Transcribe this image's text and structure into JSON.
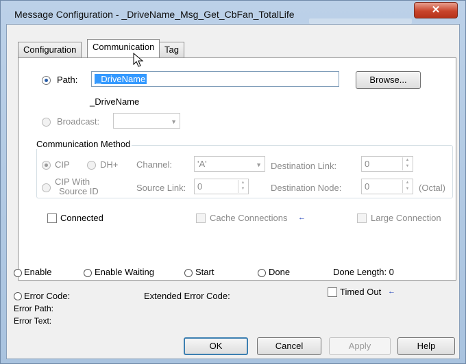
{
  "window": {
    "title": "Message Configuration - _DriveName_Msg_Get_CbFan_TotalLife",
    "close_glyph": "✕"
  },
  "tabs": [
    {
      "label": "Configuration"
    },
    {
      "label": "Communication"
    },
    {
      "label": "Tag"
    }
  ],
  "communication": {
    "path_label": "Path:",
    "path_value": "_DriveName",
    "browse_label": "Browse...",
    "path_resolved": "_DriveName",
    "broadcast_label": "Broadcast:",
    "broadcast_value": ""
  },
  "comm_method": {
    "group_label": "Communication Method",
    "cip_label": "CIP",
    "dhplus_label": "DH+",
    "channel_label": "Channel:",
    "channel_value": "'A'",
    "destination_link_label": "Destination Link:",
    "destination_link_value": "0",
    "cip_source_id_label_1": "CIP With",
    "cip_source_id_label_2": "Source ID",
    "source_link_label": "Source Link:",
    "source_link_value": "0",
    "destination_node_label": "Destination Node:",
    "destination_node_value": "0",
    "octal_label": "(Octal)"
  },
  "options": {
    "connected_label": "Connected",
    "connected_checked": false,
    "cache_label": "Cache Connections",
    "large_label": "Large Connection"
  },
  "status": {
    "enable_label": "Enable",
    "enable_waiting_label": "Enable Waiting",
    "start_label": "Start",
    "done_label": "Done",
    "done_length_label": "Done Length: 0",
    "error_code_label": "Error Code:",
    "extended_error_label": "Extended Error Code:",
    "timed_out_label": "Timed Out",
    "error_path_label": "Error Path:",
    "error_text_label": "Error Text:"
  },
  "buttons": {
    "ok": "OK",
    "cancel": "Cancel",
    "apply": "Apply",
    "help": "Help"
  },
  "icons": {
    "arrow": "←"
  }
}
